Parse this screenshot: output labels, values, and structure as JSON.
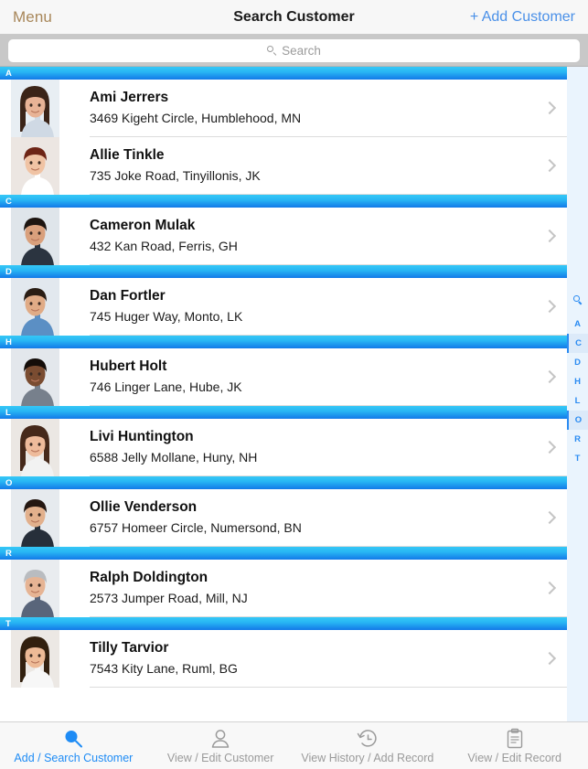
{
  "navbar": {
    "menu_label": "Menu",
    "title": "Search Customer",
    "add_label": "+ Add Customer",
    "menu_color": "#a8875a",
    "add_color": "#4a90e8"
  },
  "search": {
    "icon": "search-icon",
    "placeholder": "Search",
    "value": ""
  },
  "list": {
    "sections": [
      {
        "letter": "A",
        "rows": [
          {
            "name": "Ami Jerrers",
            "address": "3469 Kigeht Circle, Humblehood, MN",
            "avatar": "woman-dark-hair"
          },
          {
            "name": "Allie Tinkle",
            "address": "735 Joke Road, Tinyillonis, JK",
            "avatar": "woman-red-hair"
          }
        ]
      },
      {
        "letter": "C",
        "rows": [
          {
            "name": "Cameron Mulak",
            "address": "432 Kan Road, Ferris, GH",
            "avatar": "man-suit-beard"
          }
        ]
      },
      {
        "letter": "D",
        "rows": [
          {
            "name": "Dan Fortler",
            "address": "745 Huger Way, Monto, LK",
            "avatar": "man-blue-shirt"
          }
        ]
      },
      {
        "letter": "H",
        "rows": [
          {
            "name": "Hubert Holt",
            "address": "746 Linger Lane, Hube, JK",
            "avatar": "man-grey-suit"
          }
        ]
      },
      {
        "letter": "L",
        "rows": [
          {
            "name": "Livi Huntington",
            "address": "6588 Jelly Mollane, Huny, NH",
            "avatar": "woman-brown-hair"
          }
        ]
      },
      {
        "letter": "O",
        "rows": [
          {
            "name": "Ollie Venderson",
            "address": "6757 Homeer Circle, Numersond, BN",
            "avatar": "man-dark-suit"
          }
        ]
      },
      {
        "letter": "R",
        "rows": [
          {
            "name": "Ralph Doldington",
            "address": "2573 Jumper Road, Mill, NJ",
            "avatar": "man-grey-hair"
          }
        ]
      },
      {
        "letter": "T",
        "rows": [
          {
            "name": "Tilly Tarvior",
            "address": "7543 Kity Lane, Ruml, BG",
            "avatar": "woman-long-hair"
          }
        ]
      }
    ]
  },
  "index": {
    "search_icon": "search-icon",
    "letters": [
      "A",
      "C",
      "D",
      "H",
      "L",
      "O",
      "R",
      "T"
    ],
    "highlighted": [
      "C",
      "O"
    ],
    "color": "#2a8bf2"
  },
  "tabbar": {
    "accent_color": "#1f8cf5",
    "inactive_color": "#9a9a9a",
    "tabs": [
      {
        "label": "Add / Search Customer",
        "icon": "search-icon",
        "active": true
      },
      {
        "label": "View / Edit Customer",
        "icon": "person-icon",
        "active": false
      },
      {
        "label": "View History / Add Record",
        "icon": "history-clock-icon",
        "active": false
      },
      {
        "label": "View / Edit Record",
        "icon": "clipboard-icon",
        "active": false
      }
    ]
  }
}
